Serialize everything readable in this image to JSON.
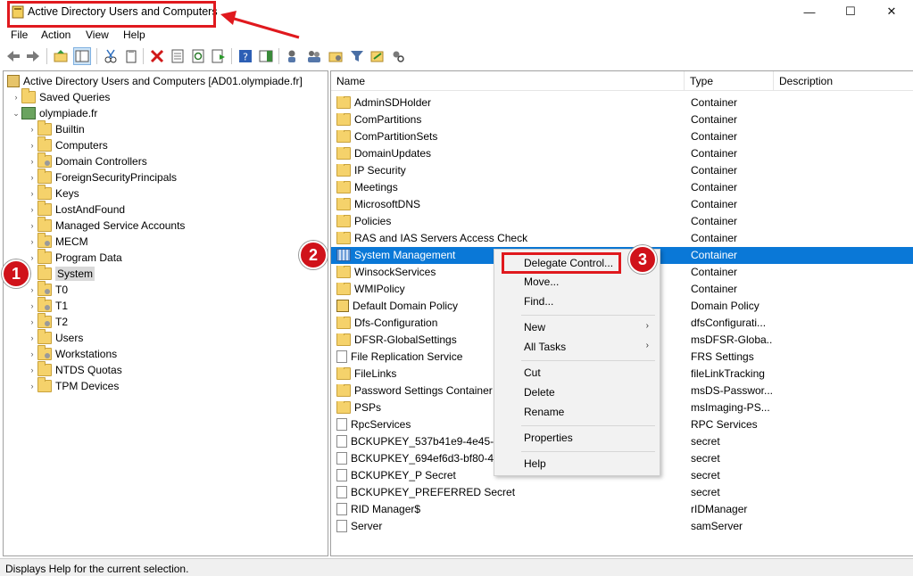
{
  "window": {
    "title": "Active Directory Users and Computers",
    "minimize": "—",
    "maximize": "☐",
    "close": "✕"
  },
  "menu": [
    "File",
    "Action",
    "View",
    "Help"
  ],
  "tree": {
    "root": "Active Directory Users and Computers [AD01.olympiade.fr]",
    "saved_queries": "Saved Queries",
    "domain": "olympiade.fr",
    "children": [
      "Builtin",
      "Computers",
      "Domain Controllers",
      "ForeignSecurityPrincipals",
      "Keys",
      "LostAndFound",
      "Managed Service Accounts",
      "MECM",
      "Program Data",
      "System",
      "T0",
      "T1",
      "T2",
      "Users",
      "Workstations",
      "NTDS Quotas",
      "TPM Devices"
    ],
    "selected": "System"
  },
  "list": {
    "columns": [
      "Name",
      "Type",
      "Description"
    ],
    "rows": [
      {
        "name": "AdminSDHolder",
        "type": "Container",
        "icon": "folder"
      },
      {
        "name": "ComPartitions",
        "type": "Container",
        "icon": "folder"
      },
      {
        "name": "ComPartitionSets",
        "type": "Container",
        "icon": "folder"
      },
      {
        "name": "DomainUpdates",
        "type": "Container",
        "icon": "folder"
      },
      {
        "name": "IP Security",
        "type": "Container",
        "icon": "folder"
      },
      {
        "name": "Meetings",
        "type": "Container",
        "icon": "folder"
      },
      {
        "name": "MicrosoftDNS",
        "type": "Container",
        "icon": "folder"
      },
      {
        "name": "Policies",
        "type": "Container",
        "icon": "folder"
      },
      {
        "name": "RAS and IAS Servers Access Check",
        "type": "Container",
        "icon": "folder"
      },
      {
        "name": "System Management",
        "type": "Container",
        "icon": "system-container"
      },
      {
        "name": "WinsockServices",
        "type": "Container",
        "icon": "folder"
      },
      {
        "name": "WMIPolicy",
        "type": "Container",
        "icon": "folder"
      },
      {
        "name": "Default Domain Policy",
        "type": "Domain Policy",
        "icon": "policy"
      },
      {
        "name": "Dfs-Configuration",
        "type": "dfsConfigurati...",
        "icon": "folder"
      },
      {
        "name": "DFSR-GlobalSettings",
        "type": "msDFSR-Globa...",
        "icon": "folder"
      },
      {
        "name": "File Replication Service",
        "type": "FRS Settings",
        "icon": "doc"
      },
      {
        "name": "FileLinks",
        "type": "fileLinkTracking",
        "icon": "folder"
      },
      {
        "name": "Password Settings Container",
        "type": "msDS-Passwor...",
        "icon": "folder"
      },
      {
        "name": "PSPs",
        "type": "msImaging-PS...",
        "icon": "folder"
      },
      {
        "name": "RpcServices",
        "type": "RPC Services",
        "icon": "doc"
      },
      {
        "name": "BCKUPKEY_537b41e9-4e45-4c",
        "type": "secret",
        "icon": "doc"
      },
      {
        "name": "BCKUPKEY_694ef6d3-bf80-423",
        "type": "secret",
        "icon": "doc"
      },
      {
        "name": "BCKUPKEY_P Secret",
        "type": "secret",
        "icon": "doc"
      },
      {
        "name": "BCKUPKEY_PREFERRED Secret",
        "type": "secret",
        "icon": "doc"
      },
      {
        "name": "RID Manager$",
        "type": "rIDManager",
        "icon": "doc"
      },
      {
        "name": "Server",
        "type": "samServer",
        "icon": "doc"
      }
    ],
    "selected_row": "System Management"
  },
  "context_menu": {
    "items": [
      "Delegate Control...",
      "Move...",
      "Find...",
      "New",
      "All Tasks",
      "Cut",
      "Delete",
      "Rename",
      "Properties",
      "Help"
    ],
    "submenu_arrow": "›"
  },
  "annotations": {
    "badge1": "1",
    "badge2": "2",
    "badge3": "3",
    "highlight_color": "#e0191e",
    "badge_color": "#d0121a"
  },
  "status": "Displays Help for the current selection.",
  "colors": {
    "selection": "#0a78d7",
    "folder": "#f5d26b"
  }
}
